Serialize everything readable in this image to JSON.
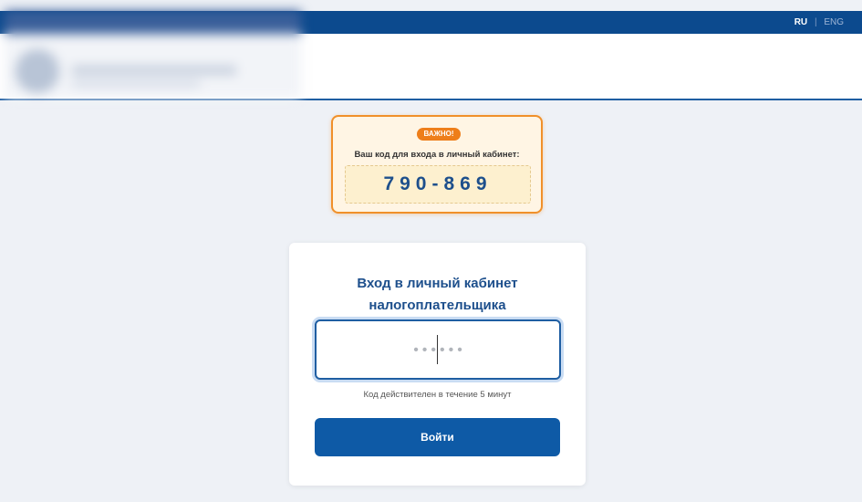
{
  "header": {
    "languages": {
      "active": "RU",
      "separator": "|",
      "other": "ENG"
    }
  },
  "notice": {
    "badge": "ВАЖНО!",
    "title": "Ваш код для входа в личный кабинет:",
    "code": "790-869"
  },
  "login": {
    "title_line1": "Вход в личный кабинет",
    "title_line2": "налогоплательщика",
    "code_input": {
      "placeholder": "••••••",
      "value": ""
    },
    "hint": "Код действителен в течение 5 минут",
    "button_label": "Войти"
  },
  "colors": {
    "brand": "#0c4a8e",
    "accent": "#ee7e1a",
    "button": "#0e5aa6",
    "code_text": "#1d4f8c"
  }
}
